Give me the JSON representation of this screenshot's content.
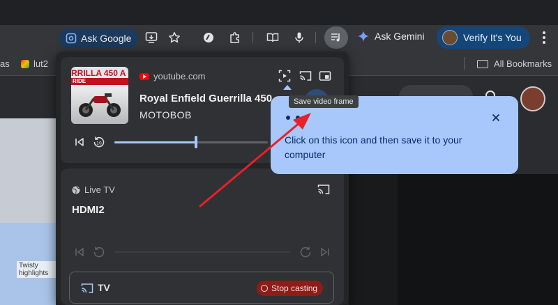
{
  "toolbar": {
    "ask_google": "Ask Google",
    "ask_gemini": "Ask Gemini",
    "verify": "Verify It's You"
  },
  "bookmarks": {
    "left_partial": "as",
    "items": [
      "lut2"
    ],
    "all_bookmarks": "All Bookmarks"
  },
  "background_page": {
    "map_label": "Twisty highlights"
  },
  "media_panel": {
    "now_playing": {
      "thumbnail_text": "RRILLA 450 A",
      "thumbnail_sub": "RIDE",
      "source": "youtube.com",
      "title": "Royal Enfield Guerrilla 450",
      "artist": "MOTOBOB",
      "progress": 0.53
    },
    "cast_device": {
      "status": "Live TV",
      "name": "HDMI2"
    },
    "device_row": {
      "label": "TV",
      "stop_label": "Stop casting"
    }
  },
  "tooltip": {
    "text": "Save video frame"
  },
  "help_bubble": {
    "message": "Click on this icon and then save it to your computer"
  },
  "colors": {
    "accent": "#a8c7fa",
    "annotation_arrow": "#e8202a",
    "stop_casting_bg": "#8c1d18"
  }
}
